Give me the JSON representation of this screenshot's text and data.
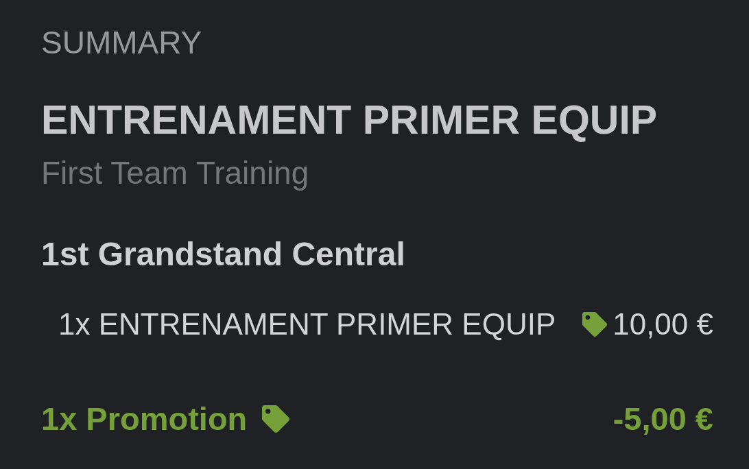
{
  "section_label": "SUMMARY",
  "event": {
    "title": "ENTRENAMENT PRIMER EQUIP",
    "subtitle": "First Team Training"
  },
  "zone": {
    "name": "1st Grandstand Central"
  },
  "lines": [
    {
      "kind": "ticket",
      "label": "1x ENTRENAMENT PRIMER EQUIP",
      "amount": "10,00 €"
    },
    {
      "kind": "discount",
      "label": "1x Promotion",
      "amount": "-5,00 €"
    }
  ]
}
